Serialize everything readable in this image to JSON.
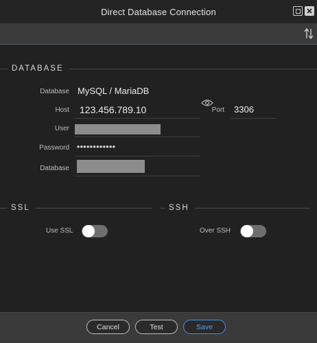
{
  "window": {
    "title": "Direct Database Connection"
  },
  "toolbar": {
    "sort_icon": "sort-arrows-icon"
  },
  "database_section": {
    "title": "DATABASE",
    "database_label": "Database",
    "database_value": "MySQL / MariaDB",
    "host_label": "Host",
    "host_value": "123.456.789.10",
    "port_label": "Port",
    "port_value": "3306",
    "user_label": "User",
    "password_label": "Password",
    "password_value": "••••••••••••",
    "database_name_label": "Database",
    "reveal_icon": "eye-icon"
  },
  "ssl_section": {
    "title": "SSL",
    "use_ssl_label": "Use SSL",
    "use_ssl_enabled": false
  },
  "ssh_section": {
    "title": "SSH",
    "over_ssh_label": "Over SSH",
    "over_ssh_enabled": false
  },
  "footer": {
    "cancel_label": "Cancel",
    "test_label": "Test",
    "save_label": "Save"
  },
  "colors": {
    "accent": "#4a90e2",
    "background": "#212121",
    "toolbar": "#3b3b3b"
  }
}
